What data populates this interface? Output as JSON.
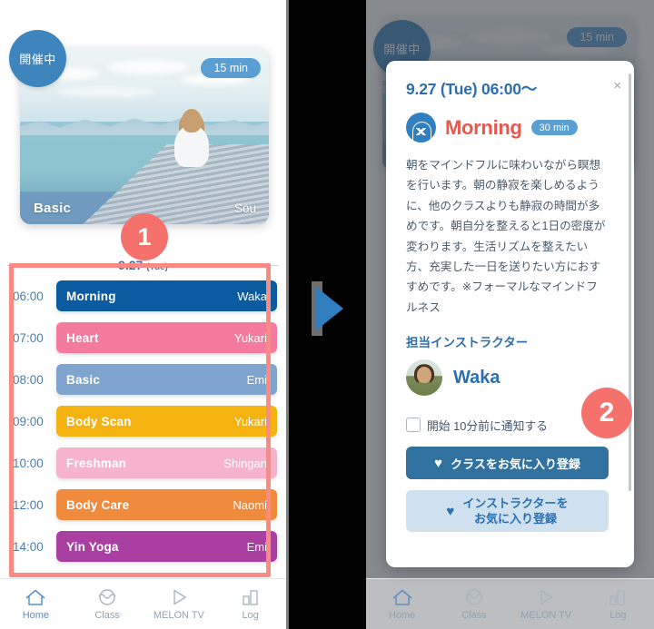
{
  "left": {
    "hero": {
      "live_badge": "開催中",
      "duration_badge": "15 min",
      "title": "Basic",
      "instructor": "Sou"
    },
    "step_badge": "1",
    "date_separator": {
      "date": "9.27",
      "weekday": "(Tue)"
    },
    "schedule": [
      {
        "time": "06:00",
        "name": "Morning",
        "instructor": "Waka",
        "color": "#0b5ba0"
      },
      {
        "time": "07:00",
        "name": "Heart",
        "instructor": "Yukari",
        "color": "#f47a9e"
      },
      {
        "time": "08:00",
        "name": "Basic",
        "instructor": "Emi",
        "color": "#7fa4cd"
      },
      {
        "time": "09:00",
        "name": "Body Scan",
        "instructor": "Yukari",
        "color": "#f5b311"
      },
      {
        "time": "10:00",
        "name": "Freshman",
        "instructor": "Shingan",
        "color": "#f7b2cd"
      },
      {
        "time": "12:00",
        "name": "Body Care",
        "instructor": "Naomi",
        "color": "#f08a3c"
      },
      {
        "time": "14:00",
        "name": "Yin Yoga",
        "instructor": "Emi",
        "color": "#a93fa0"
      }
    ],
    "nav": [
      {
        "label": "Home",
        "icon": "home-icon"
      },
      {
        "label": "Class",
        "icon": "class-icon"
      },
      {
        "label": "MELON TV",
        "icon": "play-icon"
      },
      {
        "label": "Log",
        "icon": "bar-chart-icon"
      }
    ]
  },
  "right": {
    "hero": {
      "live_badge": "開催中",
      "duration_badge": "15 min"
    },
    "step_badge": "2",
    "modal": {
      "close_label": "×",
      "date_time": "9.27 (Tue) 06:00〜",
      "class_name": "Morning",
      "class_duration": "30 min",
      "description": "朝をマインドフルに味わいながら瞑想を行います。朝の静寂を楽しめるように、他のクラスよりも静寂の時間が多めです。朝自分を整えると1日の密度が変わります。生活リズムを整えたい方、充実した一日を送りたい方におすすめです。※フォーマルなマインドフルネス",
      "instructor_heading": "担当インストラクター",
      "instructor_name": "Waka",
      "notify_checkbox_label": "開始 10分前に通知する",
      "favorite_class_label": "クラスをお気に入り登録",
      "favorite_instructor_label": "インストラクターを\nお気に入り登録",
      "heart_glyph": "♥"
    },
    "nav": [
      {
        "label": "Home",
        "icon": "home-icon"
      },
      {
        "label": "Class",
        "icon": "class-icon"
      },
      {
        "label": "MELON TV",
        "icon": "play-icon"
      },
      {
        "label": "Log",
        "icon": "bar-chart-icon"
      }
    ]
  },
  "colors": {
    "accent_blue": "#2c6fb0",
    "highlight_red": "#f98a84",
    "badge_red": "#f4726b",
    "class_title_red": "#e8584f"
  }
}
